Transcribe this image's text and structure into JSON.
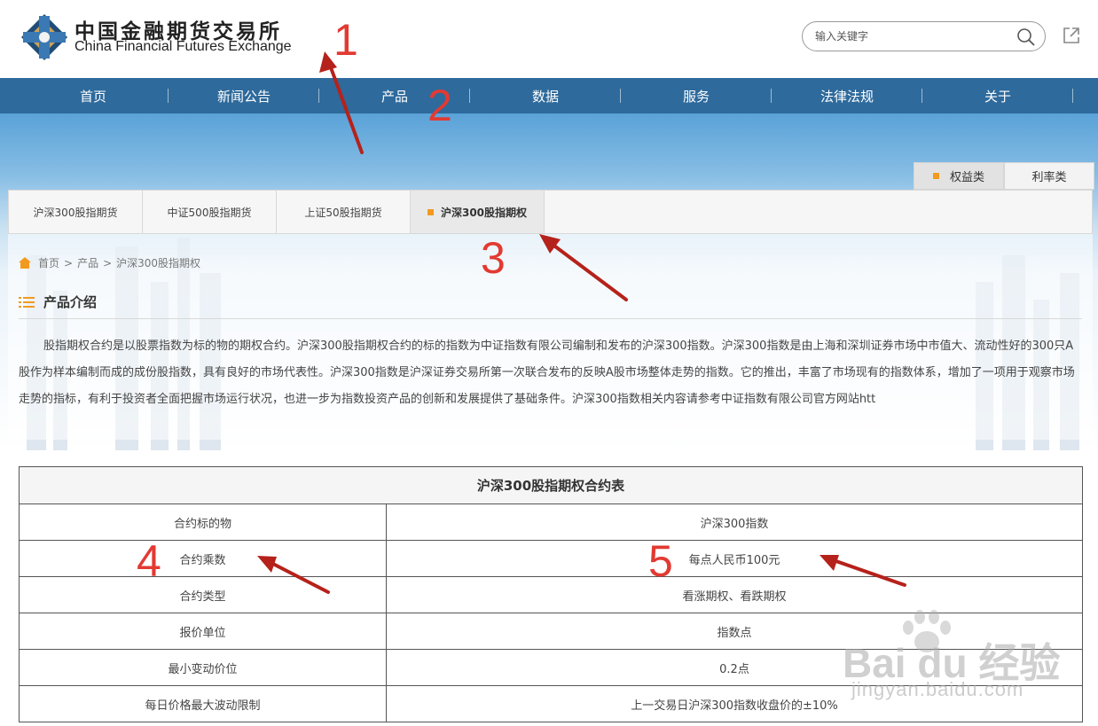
{
  "header": {
    "logo_cn": "中国金融期货交易所",
    "logo_en": "China Financial Futures Exchange",
    "search_placeholder": "输入关键字"
  },
  "nav": [
    "首页",
    "新闻公告",
    "产品",
    "数据",
    "服务",
    "法律法规",
    "关于"
  ],
  "category_tabs": [
    {
      "label": "权益类",
      "active": true
    },
    {
      "label": "利率类",
      "active": false
    }
  ],
  "product_tabs": [
    {
      "label": "沪深300股指期货",
      "active": false
    },
    {
      "label": "中证500股指期货",
      "active": false
    },
    {
      "label": "上证50股指期货",
      "active": false
    },
    {
      "label": "沪深300股指期权",
      "active": true
    }
  ],
  "breadcrumb": [
    "首页",
    "产品",
    "沪深300股指期权"
  ],
  "section_title": "产品介绍",
  "intro": "股指期权合约是以股票指数为标的物的期权合约。沪深300股指期权合约的标的指数为中证指数有限公司编制和发布的沪深300指数。沪深300指数是由上海和深圳证券市场中市值大、流动性好的300只A股作为样本编制而成的成份股指数，具有良好的市场代表性。沪深300指数是沪深证券交易所第一次联合发布的反映A股市场整体走势的指数。它的推出，丰富了市场现有的指数体系，增加了一项用于观察市场走势的指标，有利于投资者全面把握市场运行状况，也进一步为指数投资产品的创新和发展提供了基础条件。沪深300指数相关内容请参考中证指数有限公司官方网站htt",
  "table": {
    "title": "沪深300股指期权合约表",
    "rows": [
      [
        "合约标的物",
        "沪深300指数"
      ],
      [
        "合约乘数",
        "每点人民币100元"
      ],
      [
        "合约类型",
        "看涨期权、看跌期权"
      ],
      [
        "报价单位",
        "指数点"
      ],
      [
        "最小变动价位",
        "0.2点"
      ],
      [
        "每日价格最大波动限制",
        "上一交易日沪深300指数收盘价的±10%"
      ]
    ]
  },
  "annotations": [
    "1",
    "2",
    "3",
    "4",
    "5"
  ],
  "watermark": {
    "brand": "Bai du 经验",
    "url": "jingyan.baidu.com"
  },
  "colors": {
    "nav": "#2e6a9c",
    "accent": "#f29a1f",
    "annotation": "#e23a32"
  }
}
